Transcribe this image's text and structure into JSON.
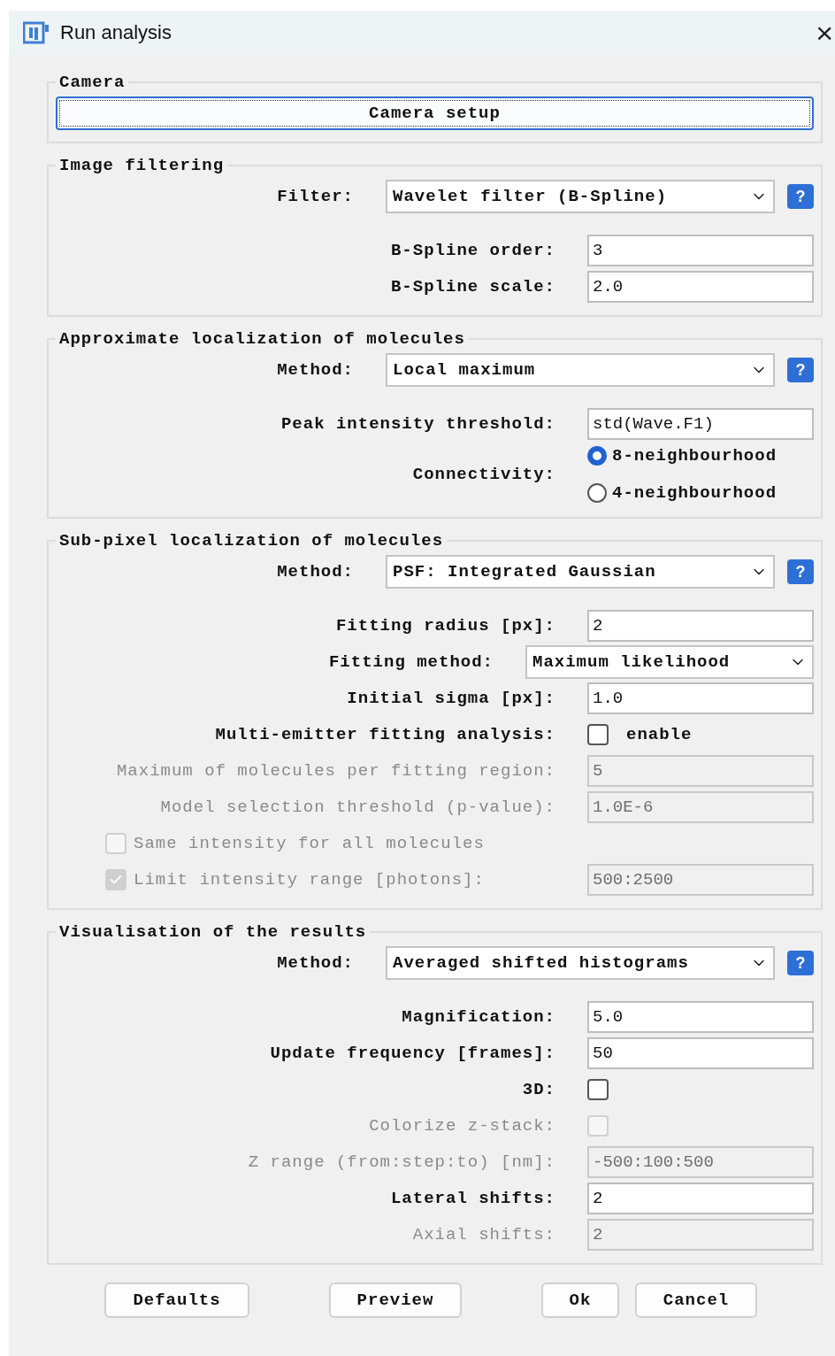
{
  "window": {
    "title": "Run analysis",
    "close": "×"
  },
  "sections": [
    {
      "title": "Camera",
      "rows": [
        {
          "kind": "button",
          "label": "Camera setup",
          "focused": true
        }
      ]
    },
    {
      "title": "Image filtering",
      "rows": [
        {
          "kind": "select",
          "label": "Filter:",
          "value": "Wavelet filter (B-Spline)",
          "help": "?"
        },
        {
          "kind": "text",
          "label": "B-Spline order:",
          "value": "3",
          "disabled": false
        },
        {
          "kind": "text",
          "label": "B-Spline scale:",
          "value": "2.0",
          "disabled": false
        }
      ]
    },
    {
      "title": "Approximate localization of molecules",
      "rows": [
        {
          "kind": "select",
          "label": "Method:",
          "value": "Local maximum",
          "help": "?"
        },
        {
          "kind": "text",
          "label": "Peak intensity threshold:",
          "value": "std(Wave.F1)",
          "disabled": false
        },
        {
          "kind": "radio",
          "label": "Connectivity:",
          "options": [
            {
              "label": "8-neighbourhood",
              "selected": true
            },
            {
              "label": "4-neighbourhood",
              "selected": false
            }
          ]
        }
      ]
    },
    {
      "title": "Sub-pixel localization of molecules",
      "rows": [
        {
          "kind": "select",
          "label": "Method:",
          "value": "PSF: Integrated Gaussian",
          "help": "?"
        },
        {
          "kind": "text",
          "label": "Fitting radius [px]:",
          "value": "2",
          "disabled": false
        },
        {
          "kind": "combo",
          "label": "Fitting method:",
          "value": "Maximum likelihood"
        },
        {
          "kind": "text",
          "label": "Initial sigma [px]:",
          "value": "1.0",
          "disabled": false
        },
        {
          "kind": "check",
          "label": "Multi-emitter fitting analysis:",
          "text": "enable",
          "checked": false,
          "disabled": false
        },
        {
          "kind": "text",
          "label": "Maximum of molecules per fitting region:",
          "value": "5",
          "disabled": true
        },
        {
          "kind": "text",
          "label": "Model selection threshold (p-value):",
          "value": "1.0E-6",
          "disabled": true
        },
        {
          "kind": "check_left",
          "text": "Same intensity for all molecules",
          "checked": false,
          "disabled": true
        },
        {
          "kind": "check_field",
          "text": "Limit intensity range [photons]:",
          "checked": true,
          "disabled": true,
          "value": "500:2500"
        }
      ]
    },
    {
      "title": "Visualisation of the results",
      "rows": [
        {
          "kind": "select",
          "label": "Method:",
          "value": "Averaged shifted histograms",
          "help": "?"
        },
        {
          "kind": "text",
          "label": "Magnification:",
          "value": "5.0",
          "disabled": false
        },
        {
          "kind": "text",
          "label": "Update frequency [frames]:",
          "value": "50",
          "disabled": false
        },
        {
          "kind": "check",
          "label": "3D:",
          "checked": false,
          "disabled": false
        },
        {
          "kind": "check",
          "label": "Colorize z-stack:",
          "checked": false,
          "disabled": true
        },
        {
          "kind": "text",
          "label": "Z range (from:step:to) [nm]:",
          "value": "-500:100:500",
          "disabled": true
        },
        {
          "kind": "text",
          "label": "Lateral shifts:",
          "value": "2",
          "disabled": false
        },
        {
          "kind": "text",
          "label": "Axial shifts:",
          "value": "2",
          "disabled": true
        }
      ]
    }
  ],
  "buttons": [
    "Defaults",
    "Preview",
    "Ok",
    "Cancel"
  ]
}
